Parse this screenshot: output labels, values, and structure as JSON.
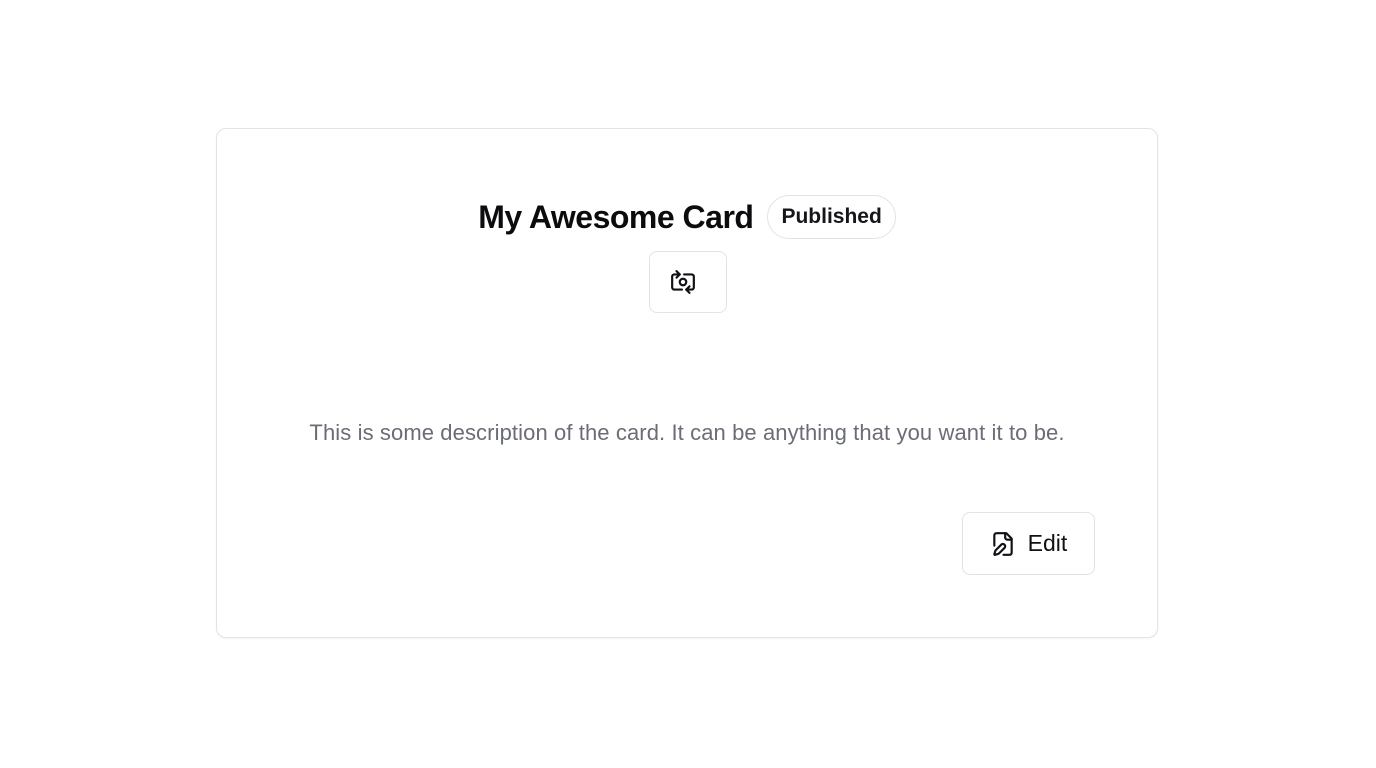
{
  "card": {
    "title": "My Awesome Card",
    "badge": "Published",
    "description": "This is some description of the card. It can be anything that you want it to be.",
    "switch_button": {
      "icon": "switch-camera-icon"
    },
    "edit_button": {
      "label": "Edit",
      "icon": "file-pen-icon"
    }
  },
  "colors": {
    "background": "#ffffff",
    "border": "#e3e3e6",
    "title": "#0c0c0f",
    "description": "#6b6d76"
  }
}
